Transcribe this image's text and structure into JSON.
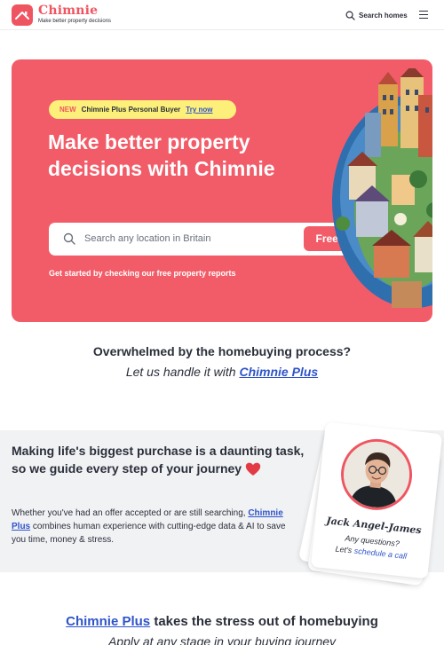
{
  "header": {
    "brand_name": "Chimnie",
    "tagline": "Make better property decisions",
    "search_label": "Search homes",
    "search_icon": "search-icon",
    "menu_icon": "hamburger-menu-icon"
  },
  "hero": {
    "badge": {
      "new": "NEW",
      "text": "Chimnie Plus Personal Buyer",
      "cta": "Try now"
    },
    "title": "Make better property decisions with Chimnie",
    "search_placeholder": "Search any location in Britain",
    "button": "Free reports",
    "subtitle": "Get started by checking our free property reports"
  },
  "overwhelmed": {
    "title": "Overwhelmed by the homebuying process?",
    "sub_prefix": "Let us handle it with ",
    "sub_link": "Chimnie Plus"
  },
  "guide": {
    "title": "Making life's biggest purchase is a daunting task, so we guide every step of your journey",
    "text_prefix": "Whether you've had an offer accepted or are still searching, ",
    "text_link": "Chimnie Plus",
    "text_suffix": " combines human experience with cutting-edge data & AI to save you time, money & stress."
  },
  "contact_card": {
    "name": "Jack Angel-James",
    "question": "Any questions?",
    "cta_prefix": "Let's ",
    "cta_link": "schedule a call"
  },
  "bottom": {
    "title_link": "Chimnie Plus",
    "title_suffix": " takes the stress out of homebuying",
    "subtitle": "Apply at any stage in your buying journey"
  },
  "colors": {
    "brand": "#ef5560",
    "hero_bg": "#f25c68",
    "link": "#2f54c9",
    "badge_bg": "#fdf07a",
    "band_bg": "#f1f2f4"
  }
}
